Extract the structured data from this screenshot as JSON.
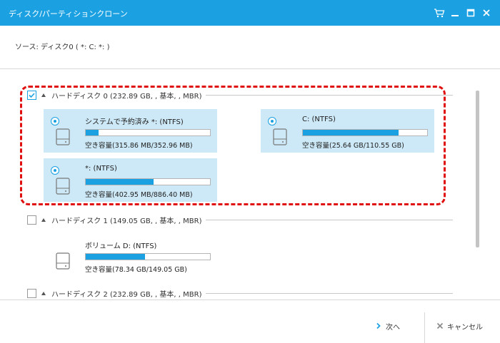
{
  "window": {
    "title": "ディスク/パーティションクローン",
    "controls": [
      "cart-icon",
      "minimize-icon",
      "maximize-icon",
      "close-icon"
    ]
  },
  "source": {
    "label": "ソース:  ディスク0 ( *: C: *: )"
  },
  "disks": [
    {
      "label": "ハードディスク 0 (232.89 GB, , 基本, , MBR)",
      "checked": true,
      "partitions": [
        {
          "name": "システムで予約済み *: (NTFS)",
          "free": "空き容量(315.86 MB/352.96 MB)",
          "used_fraction": 0.105,
          "selected": true
        },
        {
          "name": "C: (NTFS)",
          "free": "空き容量(25.64 GB/110.55 GB)",
          "used_fraction": 0.77,
          "selected": true
        },
        {
          "name": "*: (NTFS)",
          "free": "空き容量(402.95 MB/886.40 MB)",
          "used_fraction": 0.545,
          "selected": true
        }
      ]
    },
    {
      "label": "ハードディスク 1 (149.05 GB, , 基本, , MBR)",
      "checked": false,
      "partitions": [
        {
          "name": "ボリューム D: (NTFS)",
          "free": "空き容量(78.34 GB/149.05 GB)",
          "used_fraction": 0.475,
          "selected": false
        }
      ]
    },
    {
      "label": "ハードディスク 2 (232.89 GB, , 基本, , MBR)",
      "checked": false,
      "partitions": []
    }
  ],
  "footer": {
    "next_label": "次へ",
    "cancel_label": "キャンセル"
  },
  "colors": {
    "accent": "#1ba1e2",
    "selection": "#cde8f6",
    "highlight": "#e01010"
  }
}
